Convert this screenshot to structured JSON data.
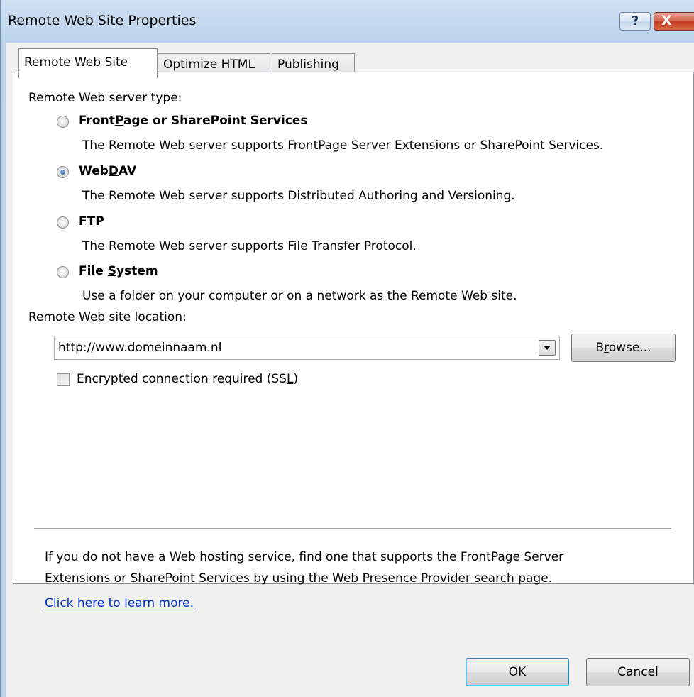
{
  "window": {
    "title": "Remote Web Site Properties",
    "help_icon": "?",
    "close_icon": "X"
  },
  "tabs": [
    {
      "label": "Remote Web Site",
      "active": true
    },
    {
      "label": "Optimize HTML",
      "active": false
    },
    {
      "label": "Publishing",
      "active": false
    }
  ],
  "server_type": {
    "heading": "Remote Web server type:",
    "options": [
      {
        "pre": "Front",
        "key": "P",
        "post": "age or SharePoint Services",
        "description": "The Remote Web server supports FrontPage Server Extensions or SharePoint Services.",
        "selected": false
      },
      {
        "pre": "Web",
        "key": "D",
        "post": "AV",
        "description": "The Remote Web server supports Distributed Authoring and Versioning.",
        "selected": true
      },
      {
        "pre": "",
        "key": "F",
        "post": "TP",
        "description": "The Remote Web server supports File Transfer Protocol.",
        "selected": false
      },
      {
        "pre": "File ",
        "key": "S",
        "post": "ystem",
        "description": "Use a folder on your computer or on a network as the Remote Web site.",
        "selected": false
      }
    ]
  },
  "location": {
    "label_pre": "Remote ",
    "label_key": "W",
    "label_post": "eb site location:",
    "value": "http://www.domeinnaam.nl",
    "browse_pre": "B",
    "browse_key": "r",
    "browse_post": "owse..."
  },
  "ssl": {
    "label_pre": "Encrypted connection required (SS",
    "label_key": "L",
    "label_post": ")",
    "checked": false
  },
  "info": {
    "line1": "If you do not have a Web hosting service, find one that supports the FrontPage Server",
    "line2": "Extensions or SharePoint Services by using the Web Presence Provider search page.",
    "link": "Click here to learn more."
  },
  "buttons": {
    "ok": "OK",
    "cancel": "Cancel"
  }
}
